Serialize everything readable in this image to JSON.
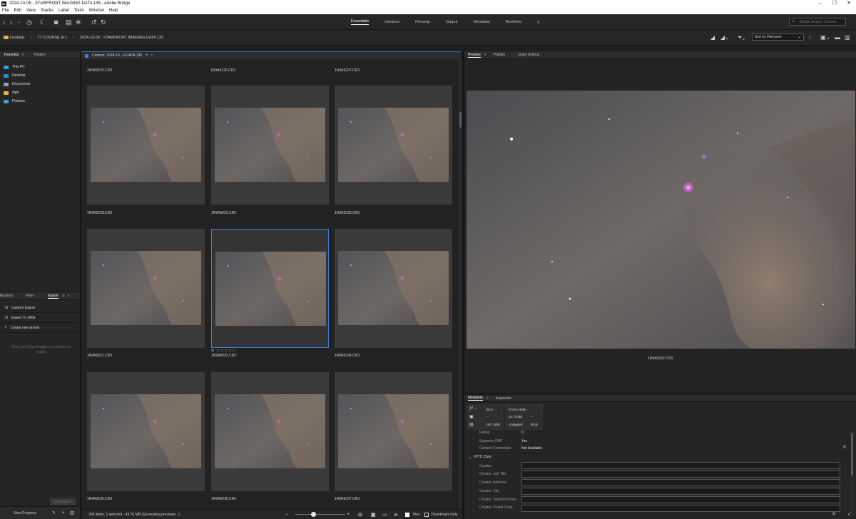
{
  "window": {
    "title": "2024-10-05 - STARFRONT IMAGING DATA 135 - Adobe Bridge",
    "app_icon": "Br",
    "minimize": "–",
    "maximize": "☐",
    "close": "✕"
  },
  "menu": [
    "File",
    "Edit",
    "View",
    "Stacks",
    "Label",
    "Tools",
    "Window",
    "Help"
  ],
  "workspaces": {
    "items": [
      "Essentials",
      "Libraries",
      "Filmstrip",
      "Output",
      "Metadata",
      "Workflow"
    ],
    "active": "Essentials",
    "more": "»"
  },
  "search": {
    "placeholder": "Bridge Search: Current"
  },
  "breadcrumb": [
    "Desktop",
    "T7 COURSE (F:)",
    "2024-10-05 - STARFRONT IMAGING DATA 135"
  ],
  "sort": {
    "label": "Sort by Filename"
  },
  "left_panel": {
    "tabs": [
      "Favorites",
      "Folders"
    ],
    "favorites": [
      {
        "label": "This PC",
        "color": "#3a9ad9"
      },
      {
        "label": "Desktop",
        "color": "#2a8bd6"
      },
      {
        "label": "Documents",
        "color": "#8aa0b5"
      },
      {
        "label": "digit",
        "color": "#e1b440"
      },
      {
        "label": "Pictures",
        "color": "#3aa0d9"
      }
    ]
  },
  "export_panel": {
    "tabs": [
      "llections",
      "Filter",
      "Export"
    ],
    "items": [
      "Custom Export",
      "Export To DNG",
      "Create new preset"
    ],
    "dropzone": "Drag and Drop images on a preset to export",
    "start_button": "Start Export",
    "view_progress": "View Progress"
  },
  "content": {
    "tab_label": "Content: 2024-10...G DATA 135",
    "top_labels": [
      "1R9A9225.CR3",
      "1R9A9226.CR3",
      "1R9A9227.CR3"
    ],
    "rows": [
      {
        "labels": [
          "1R9A9228.CR3",
          "1R9A9229.CR3",
          "1R9A9230.CR3"
        ]
      },
      {
        "labels": [
          "1R9A9231.CR3",
          "1R9A9232.CR3",
          "1R9A9234.CR3"
        ]
      },
      {
        "labels": [
          "1R9A9235.CR3",
          "1R9A9236.CR3",
          "1R9A9237.CR3"
        ]
      }
    ],
    "selected_row": 1,
    "selected_col": 1,
    "rating_stars": "⊘ ☆☆☆☆☆",
    "status": "304 items, 1 selected - 43.70 MB (Generating previews...)",
    "tiles_label": "Tiles",
    "thumbnails_only_label": "Thumbnails Only"
  },
  "preview": {
    "tabs": [
      "Preview",
      "Publish",
      "Quick Actions"
    ],
    "filename": "1R9A9232.CR3"
  },
  "metadata": {
    "tabs": [
      "Metadata",
      "Keywords"
    ],
    "camera": {
      "aperture_label": "ƒ/ --",
      "aperture": "90.0",
      "metering": "--",
      "wb": "--",
      "iso_label": "ISO 1600"
    },
    "image": {
      "dimensions": "6720 x 4480",
      "size": "43.70 MB",
      "dash": "--",
      "label": "Untagged",
      "mode": "RGB"
    },
    "rows": [
      {
        "key": "Rating",
        "value": "0"
      },
      {
        "key": "Supports XMP",
        "value": "Yes"
      },
      {
        "key": "Content Credentials",
        "value": "Not Available"
      }
    ],
    "section": "IPTC Core",
    "iptc_fields": [
      "Creator",
      "Creator: Job Title",
      "Creator: Address",
      "Creator: City",
      "Creator: State/Province",
      "Creator: Postal Code"
    ]
  },
  "colors": {
    "accent": "#3f7bd8",
    "panel": "#252525",
    "folder": "#e1b440"
  }
}
